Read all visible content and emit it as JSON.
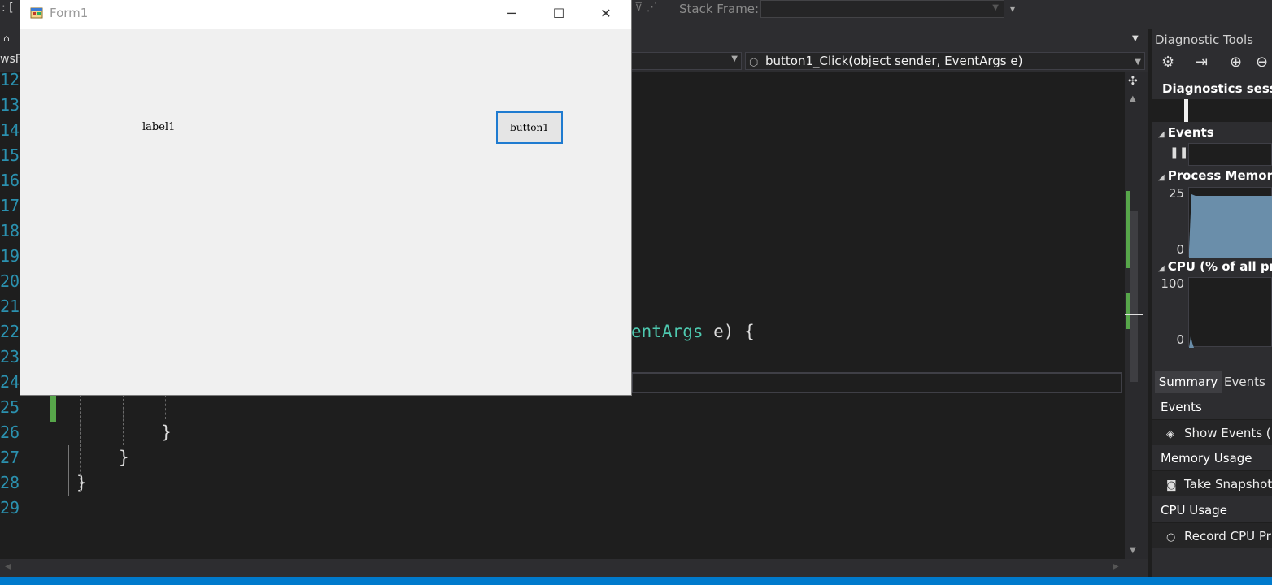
{
  "toolbar": {
    "left_fragment": ":  [",
    "stack_frame_label": "Stack Frame:",
    "stack_frame_value": ""
  },
  "editor": {
    "left_tab_fragment": "wsF",
    "member_combo": "button1_Click(object sender, EventArgs e)",
    "line_numbers": [
      "12",
      "13",
      "14",
      "15",
      "16",
      "17",
      "18",
      "19",
      "20",
      "21",
      "22",
      "23",
      "24",
      "25",
      "26",
      "27",
      "28",
      "29"
    ],
    "code_line_22_type": "entArgs",
    "code_line_22_rest": " e) {",
    "code_line_26": "}",
    "code_line_27": "}",
    "code_line_28": "}"
  },
  "form1": {
    "title": "Form1",
    "label_text": "label1",
    "button_text": "button1"
  },
  "diagnostic_tools": {
    "title": "Diagnostic Tools",
    "session_label": "Diagnostics sessio",
    "events_section": "Events",
    "process_memory_section": "Process Memory",
    "memory_axis_max": "25",
    "memory_axis_min": "0",
    "cpu_section": "CPU (% of all pro",
    "cpu_axis_max": "100",
    "cpu_axis_min": "0",
    "tabs": [
      "Summary",
      "Events"
    ],
    "summary": {
      "events_header": "Events",
      "show_events": "Show Events (",
      "memory_header": "Memory Usage",
      "take_snapshot": "Take Snapshot",
      "cpu_header": "CPU Usage",
      "record_cpu": "Record CPU Pr"
    },
    "colors": {
      "memory_fill": "#6a8eaa",
      "cpu_fill": "#6a8eaa"
    }
  }
}
